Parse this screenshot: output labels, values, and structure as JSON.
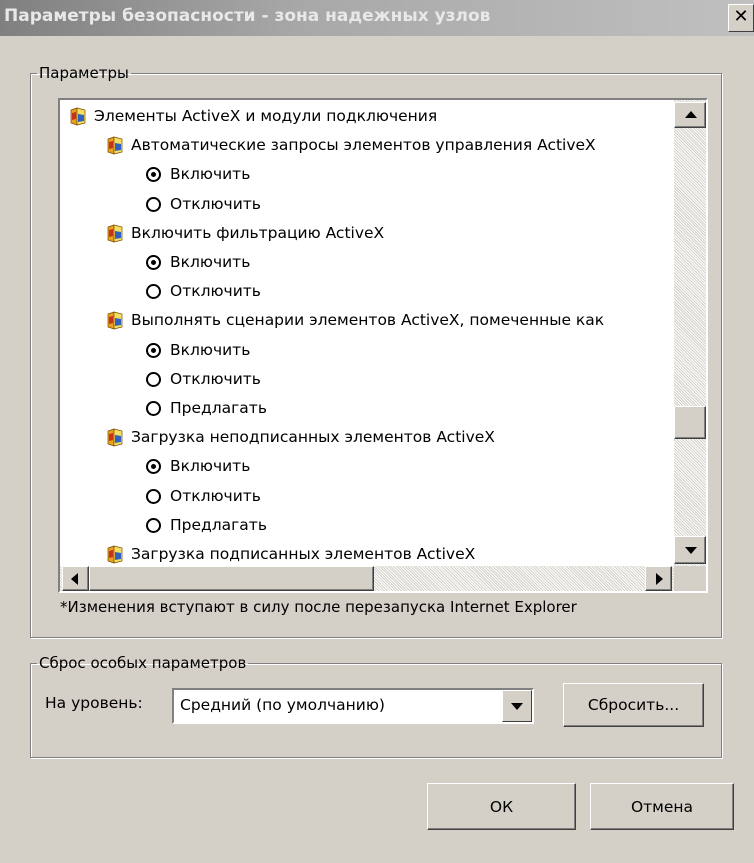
{
  "window": {
    "title": "Параметры безопасности - зона надежных узлов",
    "close_label": "✕"
  },
  "settings_group": {
    "legend": "Параметры",
    "rows": [
      {
        "type": "setting",
        "label": "Элементы ActiveX и модули подключения",
        "indent": 0
      },
      {
        "type": "setting",
        "label": "Автоматические запросы элементов управления ActiveX",
        "indent": 1
      },
      {
        "type": "radio",
        "label": "Включить",
        "checked": true,
        "indent": 2
      },
      {
        "type": "radio",
        "label": "Отключить",
        "checked": false,
        "indent": 2
      },
      {
        "type": "setting",
        "label": "Включить фильтрацию ActiveX",
        "indent": 1
      },
      {
        "type": "radio",
        "label": "Включить",
        "checked": true,
        "indent": 2
      },
      {
        "type": "radio",
        "label": "Отключить",
        "checked": false,
        "indent": 2
      },
      {
        "type": "setting",
        "label": "Выполнять сценарии элементов ActiveX, помеченные как",
        "indent": 1
      },
      {
        "type": "radio",
        "label": "Включить",
        "checked": true,
        "indent": 2
      },
      {
        "type": "radio",
        "label": "Отключить",
        "checked": false,
        "indent": 2
      },
      {
        "type": "radio",
        "label": "Предлагать",
        "checked": false,
        "indent": 2
      },
      {
        "type": "setting",
        "label": "Загрузка неподписанных элементов ActiveX",
        "indent": 1
      },
      {
        "type": "radio",
        "label": "Включить",
        "checked": true,
        "indent": 2
      },
      {
        "type": "radio",
        "label": "Отключить",
        "checked": false,
        "indent": 2
      },
      {
        "type": "radio",
        "label": "Предлагать",
        "checked": false,
        "indent": 2
      },
      {
        "type": "setting",
        "label": "Загрузка подписанных элементов ActiveX",
        "indent": 1
      }
    ],
    "vertical_scroll_position": 0.74,
    "horizontal_scroll_position": 0,
    "note": "*Изменения вступают в силу после перезапуска Internet Explorer"
  },
  "reset_group": {
    "legend": "Сброс особых параметров",
    "level_label": "На уровень:",
    "level_value": "Средний (по умолчанию)",
    "reset_button": "Сбросить..."
  },
  "buttons": {
    "ok": "ОК",
    "cancel": "Отмена"
  },
  "colors": {
    "face": "#d4d0c8",
    "title_gradient_start": "#808080",
    "list_background": "#ffffff"
  },
  "icons": {
    "setting": "ie-setting-icon",
    "radio_on": "radio-checked",
    "radio_off": "radio-unchecked",
    "scroll_up": "arrow-up-icon",
    "scroll_down": "arrow-down-icon",
    "scroll_left": "arrow-left-icon",
    "scroll_right": "arrow-right-icon",
    "combo_drop": "chevron-down-icon"
  }
}
